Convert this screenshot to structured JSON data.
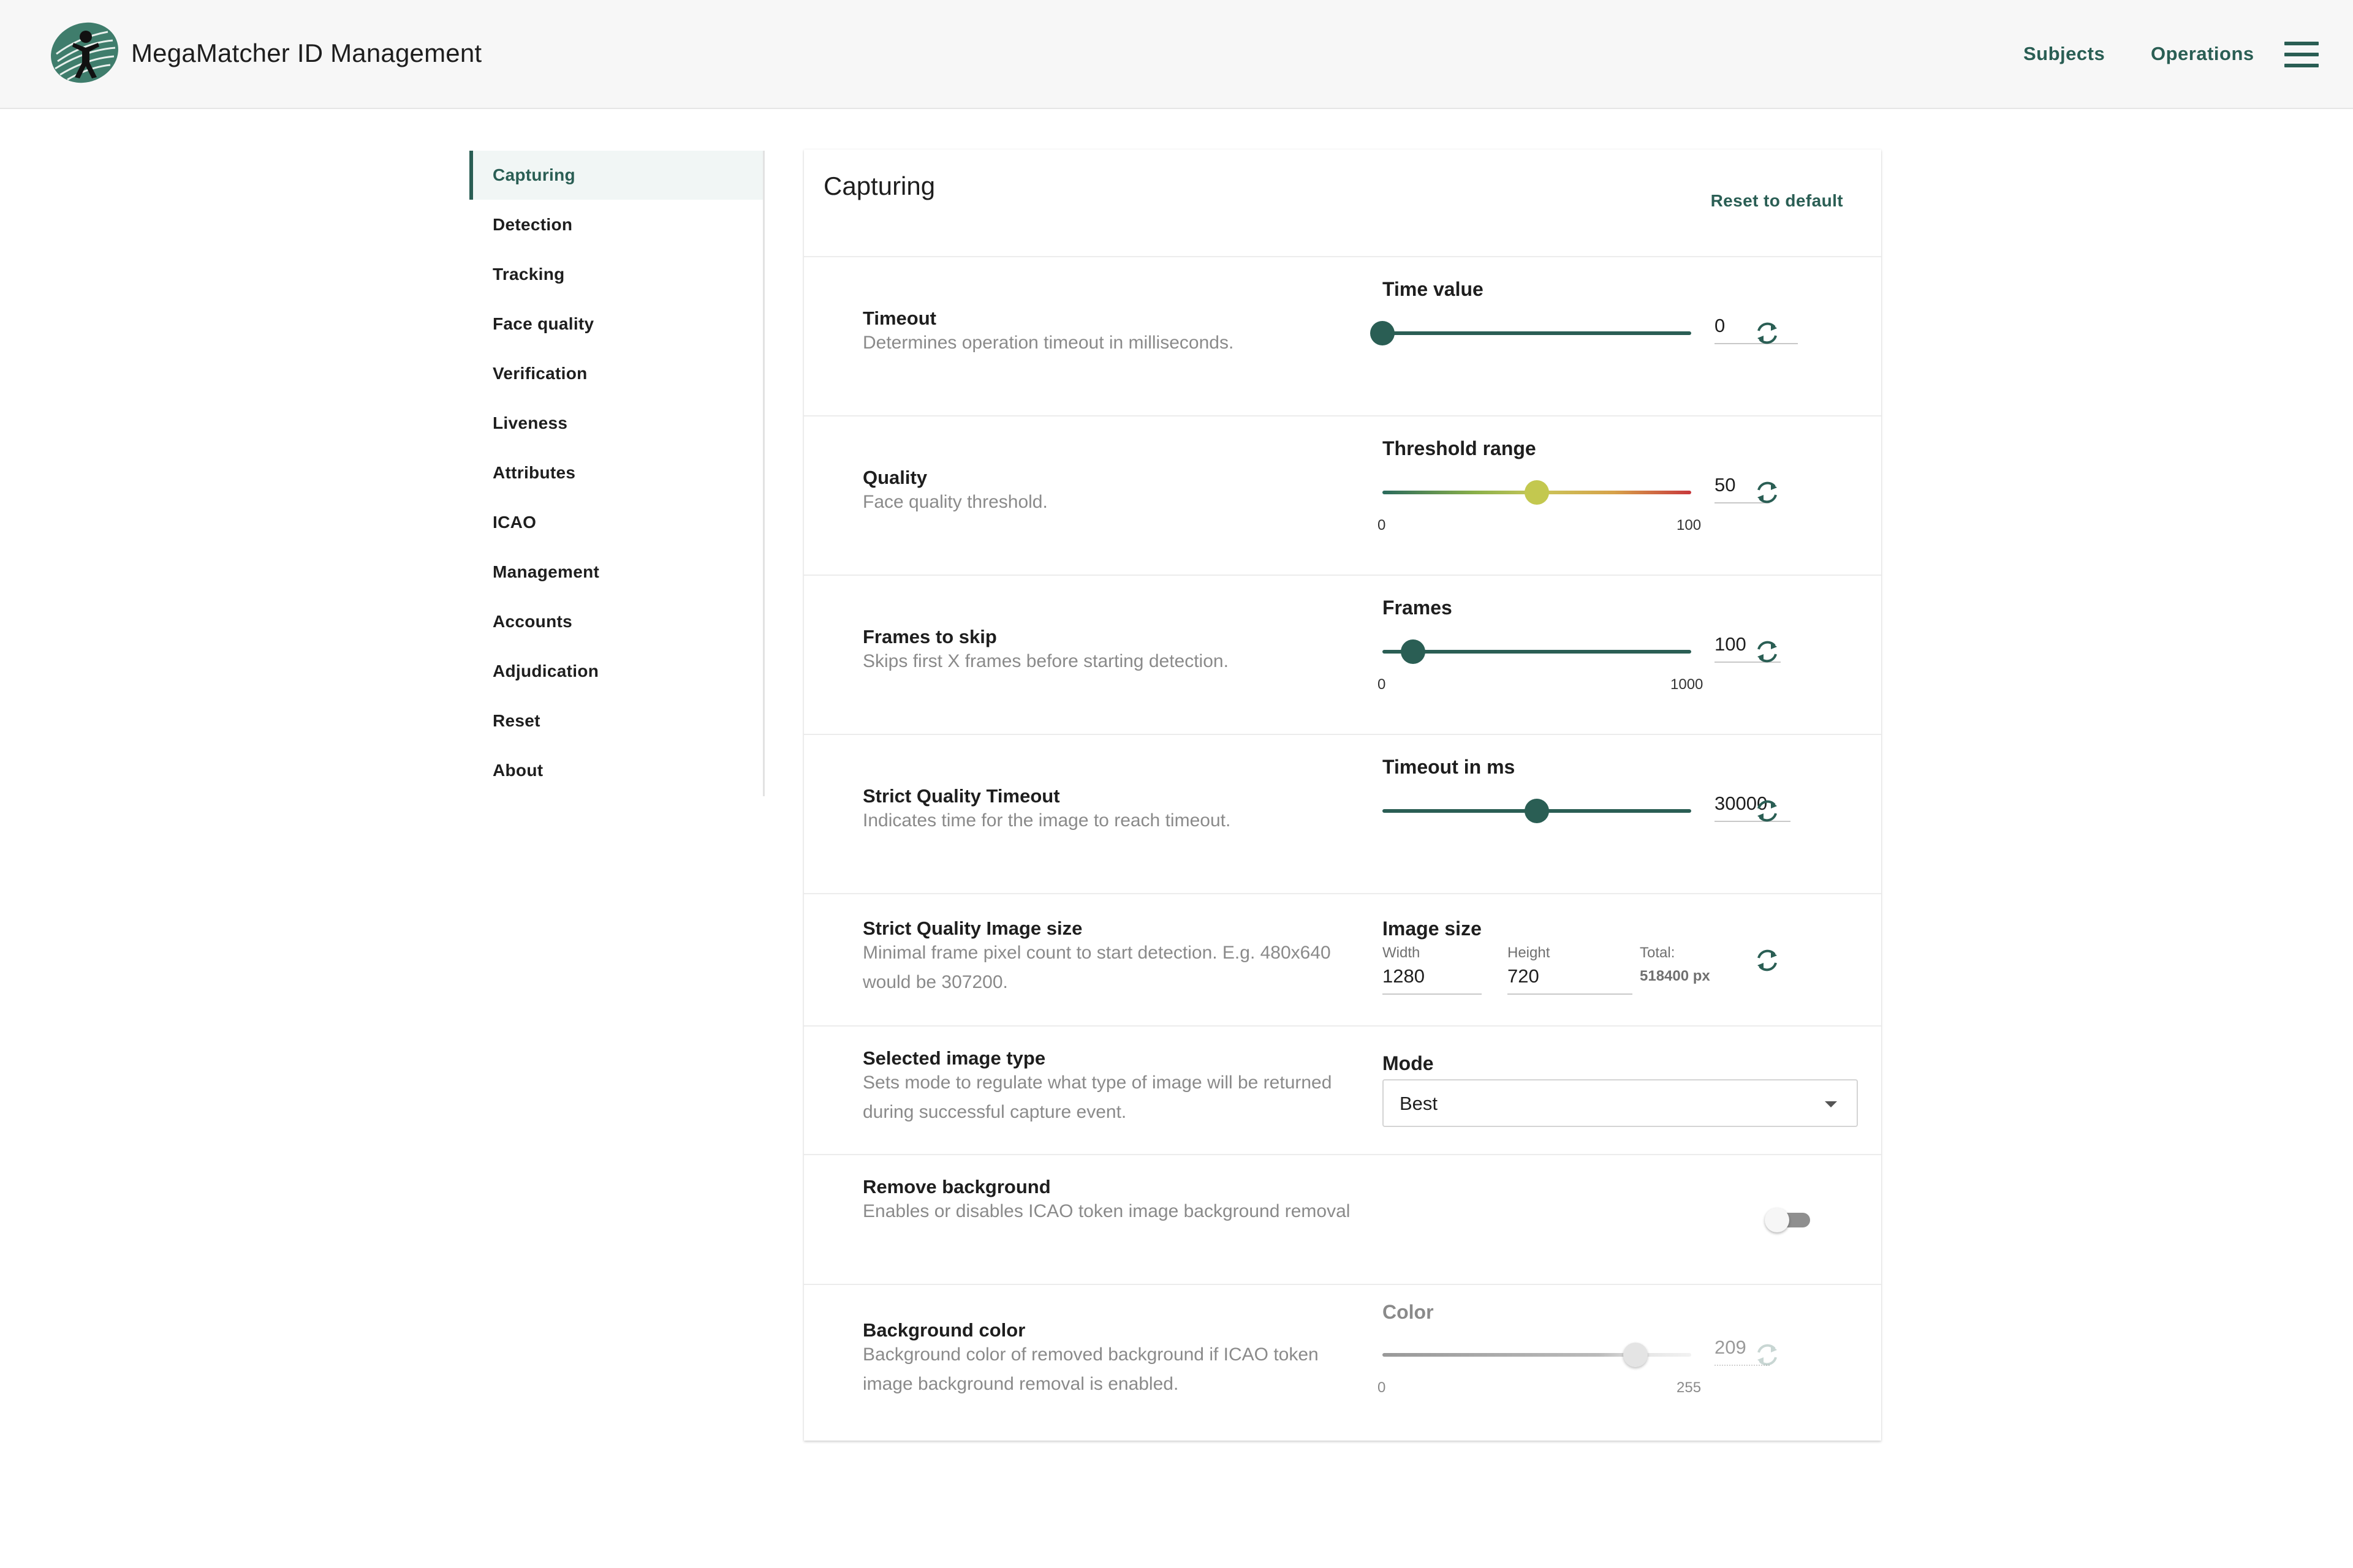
{
  "header": {
    "title": "MegaMatcher ID Management",
    "nav": [
      "Subjects",
      "Operations"
    ],
    "logo_icon": "fingerprint-person-logo",
    "menu_icon": "hamburger-menu-icon"
  },
  "sidebar": {
    "active": "Capturing",
    "items": [
      "Capturing",
      "Detection",
      "Tracking",
      "Face quality",
      "Verification",
      "Liveness",
      "Attributes",
      "ICAO",
      "Management",
      "Accounts",
      "Adjudication",
      "Reset",
      "About"
    ]
  },
  "panel": {
    "title": "Capturing",
    "reset_label": "Reset to default",
    "settings": {
      "timeout": {
        "label": "Timeout",
        "description": "Determines operation timeout in milliseconds.",
        "control_title": "Time value",
        "value": "0",
        "slider_fraction": 0.0
      },
      "quality": {
        "label": "Quality",
        "description": "Face quality threshold.",
        "control_title": "Threshold range",
        "value": "50",
        "min": "0",
        "max": "100",
        "slider_fraction": 0.5
      },
      "frames": {
        "label": "Frames to skip",
        "description": "Skips first X frames before starting detection.",
        "control_title": "Frames",
        "value": "100",
        "min": "0",
        "max": "1000",
        "slider_fraction": 0.1
      },
      "strict_timeout": {
        "label": "Strict Quality Timeout",
        "description": "Indicates time for the image to reach timeout.",
        "control_title": "Timeout in ms",
        "value": "30000",
        "slider_fraction": 0.5
      },
      "image_size": {
        "label": "Strict Quality Image size",
        "description": "Minimal frame pixel count to start detection. E.g. 480x640 would be 307200.",
        "control_title": "Image size",
        "width_label": "Width",
        "width": "1280",
        "height_label": "Height",
        "height": "720",
        "total_label": "Total:",
        "total": "518400 px"
      },
      "image_type": {
        "label": "Selected image type",
        "description": "Sets mode to regulate what type of image will be returned during successful capture event.",
        "control_title": "Mode",
        "value": "Best"
      },
      "remove_bg": {
        "label": "Remove background",
        "description": "Enables or disables ICAO token image background removal",
        "enabled": false
      },
      "bg_color": {
        "label": "Background color",
        "description": "Background color of removed background if ICAO token image background removal is enabled.",
        "control_title": "Color",
        "value": "209",
        "min": "0",
        "max": "255",
        "slider_fraction": 0.82,
        "disabled": true
      }
    }
  },
  "colors": {
    "accent": "#2a5e54",
    "quality_thumb": "#c3c84f",
    "muted_text": "#8a8a8a"
  },
  "icons": {
    "refresh": "refresh-icon",
    "dropdown": "chevron-down-icon"
  }
}
